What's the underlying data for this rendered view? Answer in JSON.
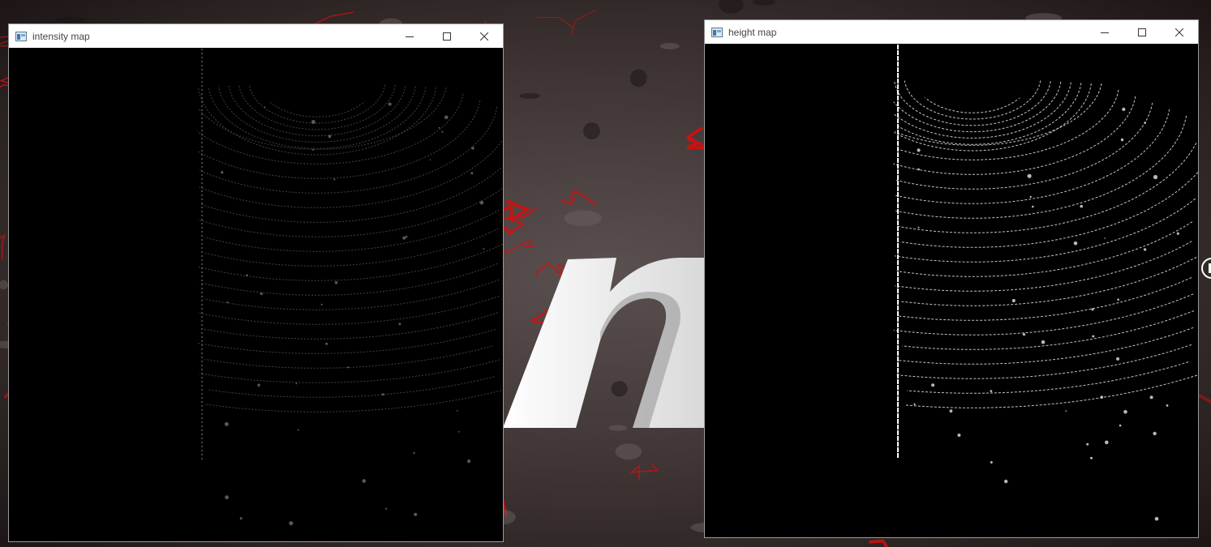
{
  "desktop": {
    "wallpaper": "red-lava-rock-texture",
    "wallpaper_logo_glyph": "n",
    "colors": {
      "rock_dark": "#2b2222",
      "lava_red": "#d01010",
      "logo_white": "#f0f0f0"
    }
  },
  "windows": [
    {
      "id": "intensity",
      "title": "intensity map",
      "icon": "window-app-icon",
      "buttons": [
        "minimize-icon",
        "maximize-icon",
        "close-icon"
      ],
      "content": "lidar-intensity-birdseye-image"
    },
    {
      "id": "height",
      "title": "height map",
      "icon": "window-app-icon",
      "buttons": [
        "minimize-icon",
        "maximize-icon",
        "close-icon"
      ],
      "content": "lidar-height-birdseye-image"
    }
  ]
}
